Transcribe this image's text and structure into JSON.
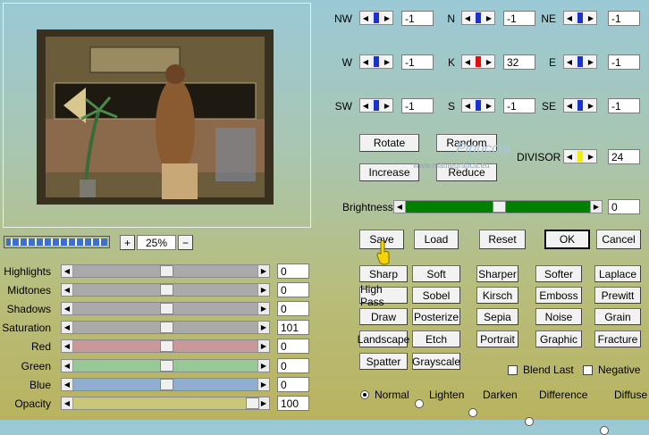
{
  "zoom": {
    "value": "25%",
    "plus": "+",
    "minus": "−"
  },
  "progress": {
    "fraction": 1.0
  },
  "compass": [
    {
      "label": "NW",
      "value": "-1",
      "color": "#1a33cc"
    },
    {
      "label": "N",
      "value": "-1",
      "color": "#1a33cc"
    },
    {
      "label": "NE",
      "value": "-1",
      "color": "#1a33cc"
    },
    {
      "label": "W",
      "value": "-1",
      "color": "#1a33cc"
    },
    {
      "label": "K",
      "value": "32",
      "color": "#e01010"
    },
    {
      "label": "E",
      "value": "-1",
      "color": "#1a33cc"
    },
    {
      "label": "SW",
      "value": "-1",
      "color": "#1a33cc"
    },
    {
      "label": "S",
      "value": "-1",
      "color": "#1a33cc"
    },
    {
      "label": "SE",
      "value": "-1",
      "color": "#1a33cc"
    }
  ],
  "buttons": {
    "rotate": "Rotate",
    "random": "Random",
    "increase": "Increase",
    "reduce": "Reduce",
    "save": "Save",
    "load": "Load",
    "reset": "Reset",
    "ok": "OK",
    "cancel": "Cancel"
  },
  "divisor": {
    "label": "DIVISOR",
    "value": "24",
    "color": "#f0f000"
  },
  "brightness": {
    "label": "Brightness",
    "value": "0",
    "level": 0.5,
    "color": "#008000"
  },
  "watermark": {
    "line1": "Pinuccia",
    "line2": "www.matitegrafica.eu"
  },
  "sliders": [
    {
      "label": "Highlights",
      "value": "0",
      "color": "#aaaaaa",
      "level": 0.5
    },
    {
      "label": "Midtones",
      "value": "0",
      "color": "#aaaaaa",
      "level": 0.5
    },
    {
      "label": "Shadows",
      "value": "0",
      "color": "#aaaaaa",
      "level": 0.5
    },
    {
      "label": "Saturation",
      "value": "101",
      "color": "#aaaaaa",
      "level": 0.5
    },
    {
      "label": "Red",
      "value": "0",
      "color": "#c99898",
      "level": 0.5
    },
    {
      "label": "Green",
      "value": "0",
      "color": "#96c996",
      "level": 0.5
    },
    {
      "label": "Blue",
      "value": "0",
      "color": "#8faed0",
      "level": 0.5
    },
    {
      "label": "Opacity",
      "value": "100",
      "color": "#c9c878",
      "level": 1.0
    }
  ],
  "presets": [
    [
      "Sharp",
      "Soft",
      "Sharper",
      "Softer",
      "Laplace"
    ],
    [
      "High Pass",
      "Sobel",
      "Kirsch",
      "Emboss",
      "Prewitt"
    ],
    [
      "Draw",
      "Posterize",
      "Sepia",
      "Noise",
      "Grain"
    ],
    [
      "Landscape",
      "Etch",
      "Portrait",
      "Graphic",
      "Fracture"
    ],
    [
      "Spatter",
      "Grayscale"
    ]
  ],
  "checks": {
    "blend_last": "Blend Last",
    "negative": "Negative"
  },
  "modes": [
    "Normal",
    "Lighten",
    "Darken",
    "Difference",
    "Diffuse"
  ],
  "selected_mode": "Normal"
}
